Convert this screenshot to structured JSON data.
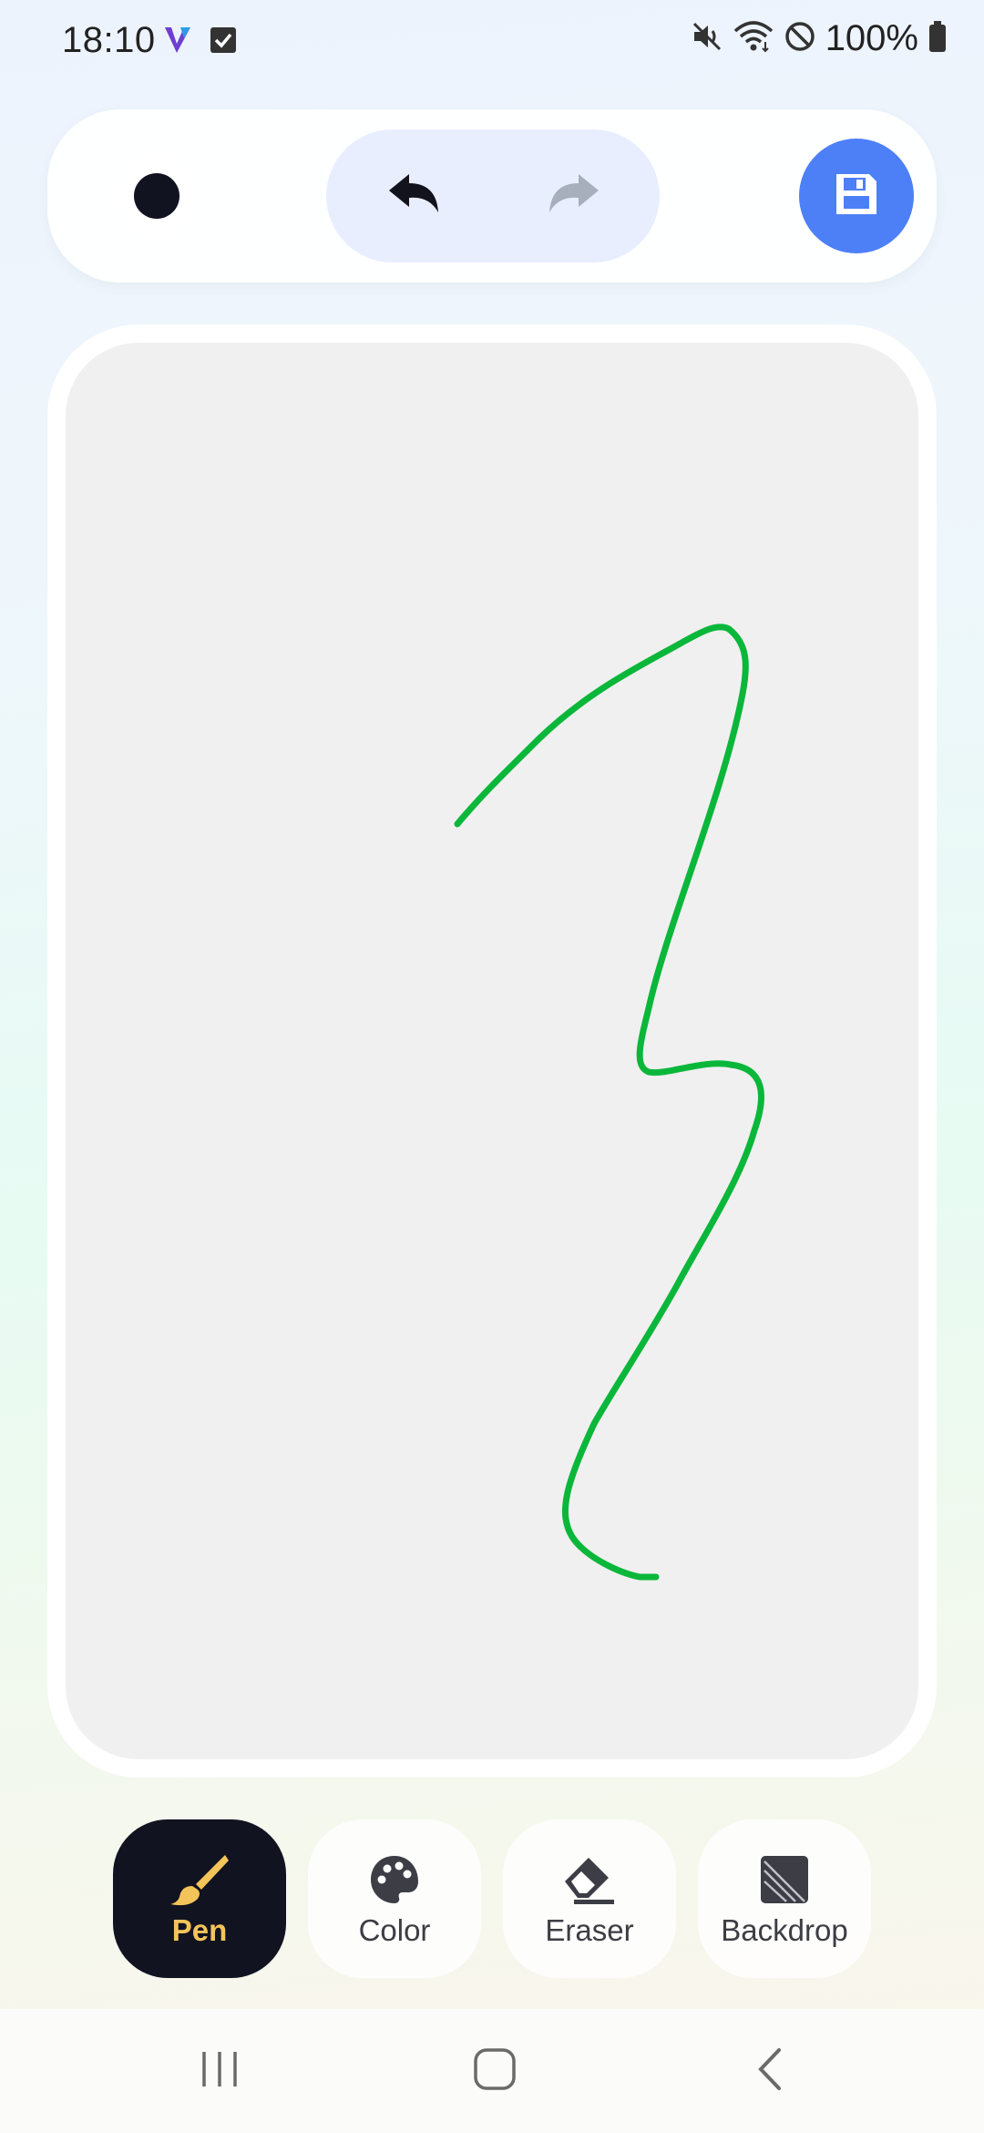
{
  "status_bar": {
    "time": "18:10",
    "battery": "100%",
    "icons": [
      "viber-icon",
      "checkbox-notification-icon",
      "mute-icon",
      "wifi-icon",
      "do-not-disturb-icon",
      "battery-icon"
    ]
  },
  "toolbar": {
    "brush_color": "#111320",
    "undo_icon": "undo-icon",
    "redo_icon": "redo-icon",
    "save_icon": "save-icon",
    "save_color": "#4d7ff7"
  },
  "canvas": {
    "background": "#f0f0f0",
    "stroke_color": "#0ab73a"
  },
  "tools": [
    {
      "label": "Pen",
      "icon": "brush-icon",
      "active": true
    },
    {
      "label": "Color",
      "icon": "palette-icon",
      "active": false
    },
    {
      "label": "Eraser",
      "icon": "eraser-icon",
      "active": false
    },
    {
      "label": "Backdrop",
      "icon": "backdrop-icon",
      "active": false
    }
  ],
  "nav": {
    "icons": [
      "recent-apps-icon",
      "home-icon",
      "back-icon"
    ]
  }
}
